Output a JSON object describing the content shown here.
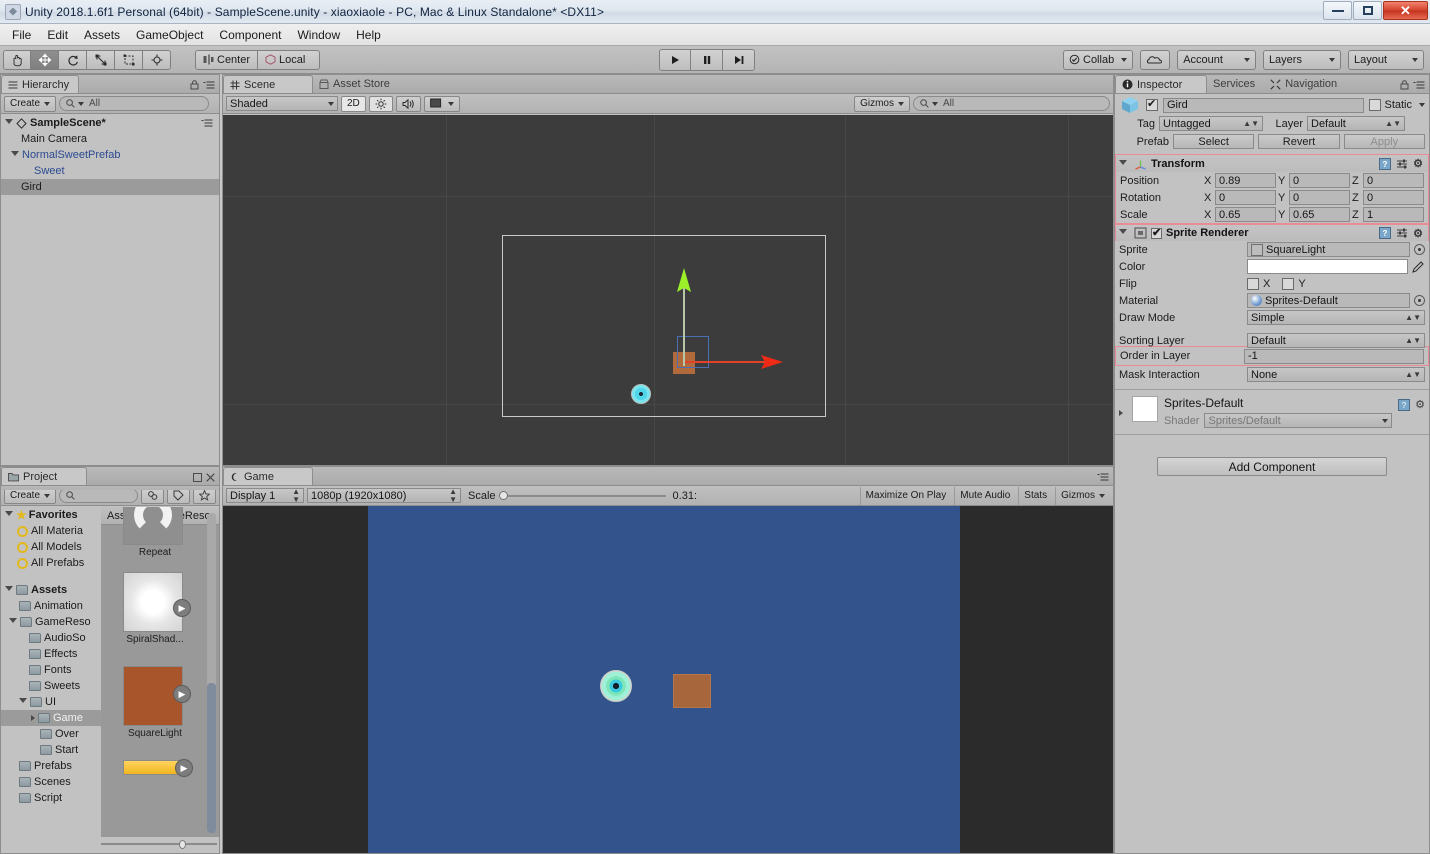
{
  "window": {
    "title": "Unity 2018.1.6f1 Personal (64bit) - SampleScene.unity - xiaoxiaole - PC, Mac & Linux Standalone* <DX11>",
    "icon": "unity-icon",
    "buttons": {
      "minimize": "minimize-button",
      "maximize": "maximize-button",
      "close": "✕"
    }
  },
  "menubar": {
    "items": [
      "File",
      "Edit",
      "Assets",
      "GameObject",
      "Component",
      "Window",
      "Help"
    ]
  },
  "toolbar": {
    "tools": [
      {
        "name": "hand-tool",
        "glyph": "hand-icon",
        "active": false
      },
      {
        "name": "move-tool",
        "glyph": "move-icon",
        "active": true
      },
      {
        "name": "rotate-tool",
        "glyph": "rotate-icon",
        "active": false
      },
      {
        "name": "scale-tool",
        "glyph": "scale-icon",
        "active": false
      },
      {
        "name": "rect-tool",
        "glyph": "rect-icon",
        "active": false
      },
      {
        "name": "transform-tool",
        "glyph": "transform-icon",
        "active": false
      }
    ],
    "pivot": "Center",
    "handle": "Local",
    "play": "▶",
    "pause": "❚❚",
    "step": "▶❙",
    "collab": "Collab",
    "cloud": "cloud-icon",
    "account": "Account",
    "layers": "Layers",
    "layout": "Layout"
  },
  "hierarchy": {
    "tab": "Hierarchy",
    "create": "Create",
    "search_placeholder": "All",
    "items": [
      {
        "label": "SampleScene*",
        "depth": 0,
        "type": "scene",
        "selected": false
      },
      {
        "label": "Main Camera",
        "depth": 1,
        "type": "object",
        "selected": false
      },
      {
        "label": "NormalSweetPrefab",
        "depth": 1,
        "type": "prefab",
        "selected": false
      },
      {
        "label": "Sweet",
        "depth": 2,
        "type": "prefab",
        "selected": false
      },
      {
        "label": "Gird",
        "depth": 1,
        "type": "object",
        "selected": true
      }
    ]
  },
  "scene": {
    "tabs": [
      {
        "label": "Scene",
        "active": true,
        "icon": "grid-icon"
      },
      {
        "label": "Asset Store",
        "active": false,
        "icon": "store-icon"
      }
    ],
    "shading": "Shaded",
    "mode2d": "2D",
    "lighting_icon": "sun-icon",
    "audio_icon": "speaker-icon",
    "fx_icon": "image-icon",
    "gizmos": "Gizmos",
    "search_placeholder": "All"
  },
  "project": {
    "tab": "Project",
    "create": "Create",
    "search_placeholder": "",
    "icons": [
      "filter-type-icon",
      "filter-label-icon",
      "favorite-star-icon"
    ],
    "tree": [
      {
        "label": "Favorites",
        "depth": 0,
        "type": "star",
        "bold": true,
        "selected": false
      },
      {
        "label": "All Materia",
        "depth": 1,
        "type": "search",
        "selected": false
      },
      {
        "label": "All Models",
        "depth": 1,
        "type": "search",
        "selected": false
      },
      {
        "label": "All Prefabs",
        "depth": 1,
        "type": "search",
        "selected": false
      },
      {
        "label": "",
        "depth": 0,
        "type": "spacer",
        "selected": false
      },
      {
        "label": "Assets",
        "depth": 0,
        "type": "folder",
        "bold": true,
        "expanded": true,
        "selected": false
      },
      {
        "label": "Animation",
        "depth": 1,
        "type": "folder",
        "selected": false
      },
      {
        "label": "GameReso",
        "depth": 1,
        "type": "folder",
        "expanded": true,
        "selected": false
      },
      {
        "label": "AudioSo",
        "depth": 2,
        "type": "folder",
        "selected": false
      },
      {
        "label": "Effects",
        "depth": 2,
        "type": "folder",
        "selected": false
      },
      {
        "label": "Fonts",
        "depth": 2,
        "type": "folder",
        "selected": false
      },
      {
        "label": "Sweets",
        "depth": 2,
        "type": "folder",
        "selected": false
      },
      {
        "label": "UI",
        "depth": 2,
        "type": "folder",
        "expanded": true,
        "selected": false
      },
      {
        "label": "Game",
        "depth": 3,
        "type": "folder",
        "collapsed": true,
        "selected": true
      },
      {
        "label": "Over",
        "depth": 3,
        "type": "folder",
        "selected": false
      },
      {
        "label": "Start",
        "depth": 3,
        "type": "folder",
        "selected": false
      },
      {
        "label": "Prefabs",
        "depth": 1,
        "type": "folder",
        "selected": false
      },
      {
        "label": "Scenes",
        "depth": 1,
        "type": "folder",
        "selected": false
      },
      {
        "label": "Script",
        "depth": 1,
        "type": "folder",
        "selected": false
      }
    ],
    "breadcrumb": [
      "Assets",
      "GameReso"
    ],
    "assets": [
      {
        "label": "Repeat",
        "color": "#8f8f8f"
      },
      {
        "label": "SpiralShad...",
        "color": "#d8d8d8"
      },
      {
        "label": "SquareLight",
        "color": "#a8552c"
      },
      {
        "label": "",
        "color": "#f5c94a"
      }
    ]
  },
  "game": {
    "tab": "Game",
    "display": "Display 1",
    "resolution": "1080p (1920x1080)",
    "scale_label": "Scale",
    "scale_value": "0.31:",
    "maximize": "Maximize On Play",
    "mute": "Mute Audio",
    "stats": "Stats",
    "gizmos": "Gizmos",
    "background_color": "#33538c"
  },
  "inspector": {
    "tabs": [
      {
        "label": "Inspector",
        "active": true,
        "icon": "info-icon"
      },
      {
        "label": "Services",
        "active": false,
        "icon": ""
      },
      {
        "label": "Navigation",
        "active": false,
        "icon": "navigation-icon"
      }
    ],
    "object_name": "Gird",
    "object_enabled": true,
    "static_label": "Static",
    "static_checked": false,
    "tag_label": "Tag",
    "tag_value": "Untagged",
    "layer_label": "Layer",
    "layer_value": "Default",
    "prefab_label": "Prefab",
    "prefab_select": "Select",
    "prefab_revert": "Revert",
    "prefab_apply": "Apply",
    "transform": {
      "title": "Transform",
      "highlighted": true,
      "rows": [
        {
          "label": "Position",
          "x": "0.89",
          "y": "0",
          "z": "0"
        },
        {
          "label": "Rotation",
          "x": "0",
          "y": "0",
          "z": "0"
        },
        {
          "label": "Scale",
          "x": "0.65",
          "y": "0.65",
          "z": "1"
        }
      ]
    },
    "sprite_renderer": {
      "title": "Sprite Renderer",
      "enabled": true,
      "sprite_label": "Sprite",
      "sprite_value": "SquareLight",
      "color_label": "Color",
      "color_value": "#ffffff",
      "flip_label": "Flip",
      "flip_x_label": "X",
      "flip_y_label": "Y",
      "flip_x": false,
      "flip_y": false,
      "material_label": "Material",
      "material_value": "Sprites-Default",
      "draw_mode_label": "Draw Mode",
      "draw_mode_value": "Simple",
      "sorting_layer_label": "Sorting Layer",
      "sorting_layer_value": "Default",
      "order_label": "Order in Layer",
      "order_value": "-1",
      "order_highlighted": true,
      "mask_label": "Mask Interaction",
      "mask_value": "None"
    },
    "material": {
      "name": "Sprites-Default",
      "shader_label": "Shader",
      "shader_value": "Sprites/Default"
    },
    "add_component": "Add Component"
  }
}
